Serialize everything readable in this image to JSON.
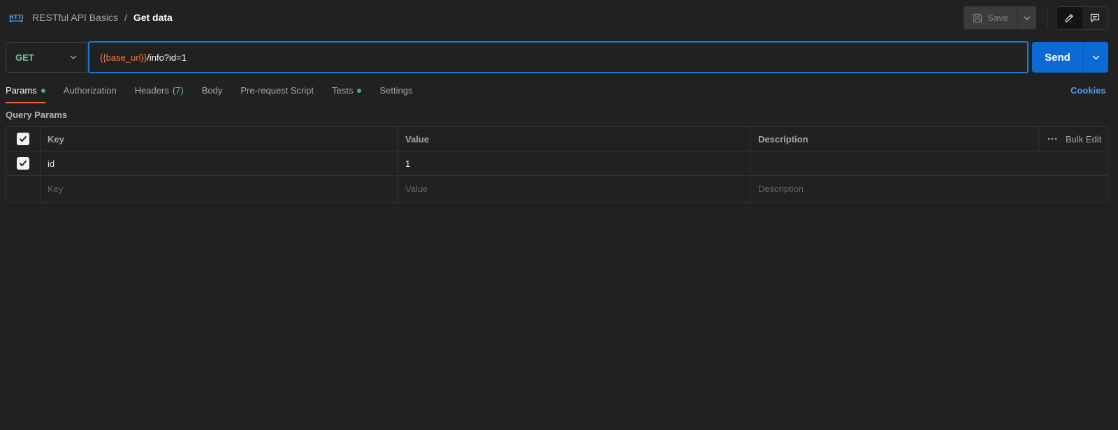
{
  "header": {
    "breadcrumb_parent": "RESTful API Basics",
    "breadcrumb_separator": "/",
    "breadcrumb_current": "Get data",
    "save_label": "Save",
    "icons": [
      "http-icon",
      "save-icon",
      "chevron-down-icon",
      "pencil-icon",
      "comment-icon"
    ]
  },
  "request": {
    "method": "GET",
    "url_variable": "{{base_url}}",
    "url_rest": "/info?id=1",
    "send_label": "Send"
  },
  "tabs": [
    {
      "label": "Params",
      "active": true,
      "dot": true
    },
    {
      "label": "Authorization"
    },
    {
      "label": "Headers",
      "count": "(7)"
    },
    {
      "label": "Body"
    },
    {
      "label": "Pre-request Script"
    },
    {
      "label": "Tests",
      "dot": true
    },
    {
      "label": "Settings"
    }
  ],
  "cookies_label": "Cookies",
  "query_params": {
    "title": "Query Params",
    "columns": {
      "key": "Key",
      "value": "Value",
      "description": "Description",
      "bulk_edit": "Bulk Edit"
    },
    "rows": [
      {
        "checked": true,
        "key": "id",
        "value": "1",
        "description": ""
      }
    ],
    "placeholders": {
      "key": "Key",
      "value": "Value",
      "description": "Description"
    }
  },
  "colors": {
    "background": "#212121",
    "accent_blue": "#0c6ad5",
    "method_green": "#6ec594",
    "variable_orange": "#ef7e4a",
    "tab_underline": "#ef6a3a",
    "dot_green": "#2fbf71"
  }
}
